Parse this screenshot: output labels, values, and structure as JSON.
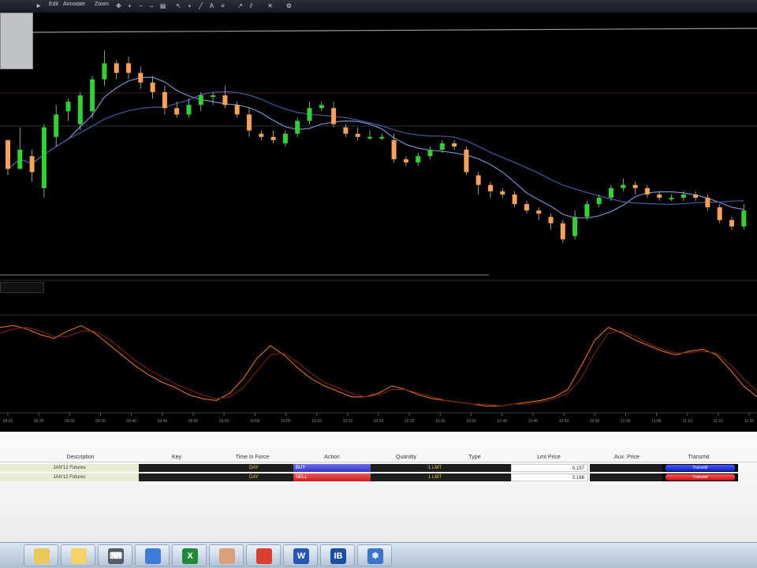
{
  "toolbar": {
    "menu": [
      "Edit",
      "Annotate",
      "Zoom"
    ]
  },
  "chart_data": {
    "type": "candlestick",
    "price_panel": {
      "candles": [
        [
          70,
          52,
          48,
          60
        ],
        [
          52,
          64,
          62,
          78
        ],
        [
          60,
          50,
          44,
          64
        ],
        [
          40,
          78,
          34,
          80
        ],
        [
          72,
          86,
          66,
          92
        ],
        [
          88,
          94,
          82,
          96
        ],
        [
          80,
          98,
          76,
          100
        ],
        [
          88,
          108,
          84,
          110
        ],
        [
          108,
          118,
          104,
          126
        ],
        [
          118,
          112,
          108,
          120
        ],
        [
          118,
          112,
          108,
          122
        ],
        [
          112,
          106,
          102,
          116
        ],
        [
          106,
          100,
          96,
          110
        ],
        [
          100,
          90,
          86,
          104
        ],
        [
          90,
          86,
          84,
          94
        ],
        [
          86,
          92,
          84,
          96
        ],
        [
          92,
          98,
          88,
          100
        ],
        [
          98,
          98,
          92,
          100
        ],
        [
          98,
          92,
          90,
          104
        ],
        [
          92,
          86,
          84,
          94
        ],
        [
          86,
          76,
          72,
          90
        ],
        [
          74,
          72,
          70,
          76
        ],
        [
          72,
          70,
          68,
          76
        ],
        [
          68,
          74,
          66,
          76
        ],
        [
          74,
          82,
          72,
          84
        ],
        [
          82,
          90,
          80,
          94
        ],
        [
          90,
          92,
          88,
          94
        ],
        [
          90,
          80,
          78,
          94
        ],
        [
          78,
          74,
          72,
          80
        ],
        [
          74,
          72,
          70,
          78
        ],
        [
          72,
          72,
          70,
          76
        ],
        [
          72,
          72,
          70,
          74
        ],
        [
          70,
          58,
          56,
          74
        ],
        [
          58,
          56,
          54,
          60
        ],
        [
          56,
          60,
          54,
          62
        ],
        [
          60,
          64,
          58,
          66
        ],
        [
          64,
          68,
          62,
          70
        ],
        [
          68,
          66,
          64,
          70
        ],
        [
          64,
          50,
          48,
          66
        ],
        [
          48,
          42,
          36,
          50
        ],
        [
          42,
          38,
          34,
          44
        ],
        [
          38,
          36,
          34,
          40
        ],
        [
          36,
          30,
          28,
          38
        ],
        [
          30,
          26,
          24,
          32
        ],
        [
          26,
          24,
          20,
          28
        ],
        [
          22,
          18,
          14,
          24
        ],
        [
          18,
          8,
          6,
          20
        ],
        [
          10,
          22,
          8,
          26
        ],
        [
          22,
          30,
          20,
          32
        ],
        [
          30,
          34,
          28,
          36
        ],
        [
          34,
          40,
          32,
          42
        ],
        [
          40,
          42,
          38,
          46
        ],
        [
          42,
          40,
          36,
          44
        ],
        [
          40,
          36,
          34,
          42
        ],
        [
          36,
          34,
          32,
          38
        ],
        [
          34,
          34,
          32,
          36
        ],
        [
          34,
          36,
          32,
          38
        ],
        [
          36,
          34,
          32,
          38
        ],
        [
          34,
          28,
          26,
          36
        ],
        [
          28,
          20,
          18,
          30
        ],
        [
          20,
          16,
          14,
          22
        ],
        [
          16,
          26,
          14,
          30
        ]
      ],
      "moving_averages": [
        "fast",
        "slow"
      ],
      "upColor": "#33d133",
      "downColor": "#f6a15c",
      "yRange": [
        0,
        130
      ]
    },
    "oscillator_panel": {
      "series": [
        {
          "values": [
            90,
            92,
            88,
            82,
            78,
            86,
            92,
            84,
            72,
            60,
            48,
            38,
            30,
            24,
            16,
            12,
            10,
            18,
            34,
            56,
            70,
            60,
            46,
            34,
            26,
            20,
            14,
            14,
            18,
            26,
            22,
            16,
            12,
            10,
            8,
            6,
            4,
            4,
            6,
            8,
            10,
            14,
            22,
            48,
            76,
            90,
            84,
            76,
            70,
            64,
            60,
            64,
            66,
            60,
            44,
            26,
            14
          ],
          "color": "#e0712a"
        },
        {
          "values": [
            84,
            88,
            90,
            86,
            80,
            80,
            86,
            86,
            78,
            66,
            54,
            44,
            36,
            28,
            22,
            16,
            12,
            14,
            24,
            42,
            60,
            62,
            52,
            40,
            30,
            24,
            18,
            14,
            16,
            22,
            22,
            18,
            14,
            10,
            8,
            6,
            6,
            4,
            6,
            6,
            8,
            12,
            18,
            34,
            62,
            84,
            86,
            80,
            72,
            66,
            62,
            62,
            64,
            62,
            50,
            34,
            20
          ],
          "color": "#7a2410"
        }
      ],
      "yRange": [
        0,
        100
      ]
    },
    "time_ticks": [
      "09:20",
      "09:25",
      "09:30",
      "09:35",
      "09:40",
      "09:45",
      "09:50",
      "09:55",
      "10:00",
      "10:05",
      "10:10",
      "10:15",
      "10:20",
      "10:25",
      "10:30",
      "10:35",
      "10:40",
      "10:45",
      "10:50",
      "10:55",
      "11:00",
      "11:05",
      "11:10",
      "11:15",
      "11:20"
    ]
  },
  "orders": {
    "columns": [
      "Description",
      "Key",
      "Time in Force",
      "Action",
      "Quantity",
      "Type",
      "Lmt Price",
      "Aux. Price",
      "Transmit"
    ],
    "rows": [
      {
        "desc": "JAN'12 Futures",
        "tif": "DAY",
        "action": "BUY",
        "quantity": "1",
        "type": "LMT",
        "lmt": "5.157",
        "transmit": "Transmit"
      },
      {
        "desc": "JAN'12 Futures",
        "tif": "DAY",
        "action": "SELL",
        "quantity": "1",
        "type": "LMT",
        "lmt": "5.166",
        "transmit": "Transmit"
      }
    ]
  },
  "taskbar": {
    "apps": [
      {
        "name": "file-explorer-icon",
        "glyph": "",
        "color": "#e8c95a"
      },
      {
        "name": "folder-icon",
        "glyph": "",
        "color": "#f2d46a"
      },
      {
        "name": "keyboard-icon",
        "glyph": "⌨",
        "color": "#555b66"
      },
      {
        "name": "remote-desktop-icon",
        "glyph": "",
        "color": "#3b7dd8"
      },
      {
        "name": "excel-icon",
        "glyph": "X",
        "color": "#1f8a3a"
      },
      {
        "name": "application-icon",
        "glyph": "",
        "color": "#d9a07b"
      },
      {
        "name": "chrome-icon",
        "glyph": "",
        "color": "#d94030"
      },
      {
        "name": "word-icon",
        "glyph": "W",
        "color": "#2756b3"
      },
      {
        "name": "tws-icon",
        "glyph": "IB",
        "color": "#1b4f9c"
      },
      {
        "name": "snowflake-icon",
        "glyph": "❄",
        "color": "#3b74c9"
      }
    ]
  }
}
